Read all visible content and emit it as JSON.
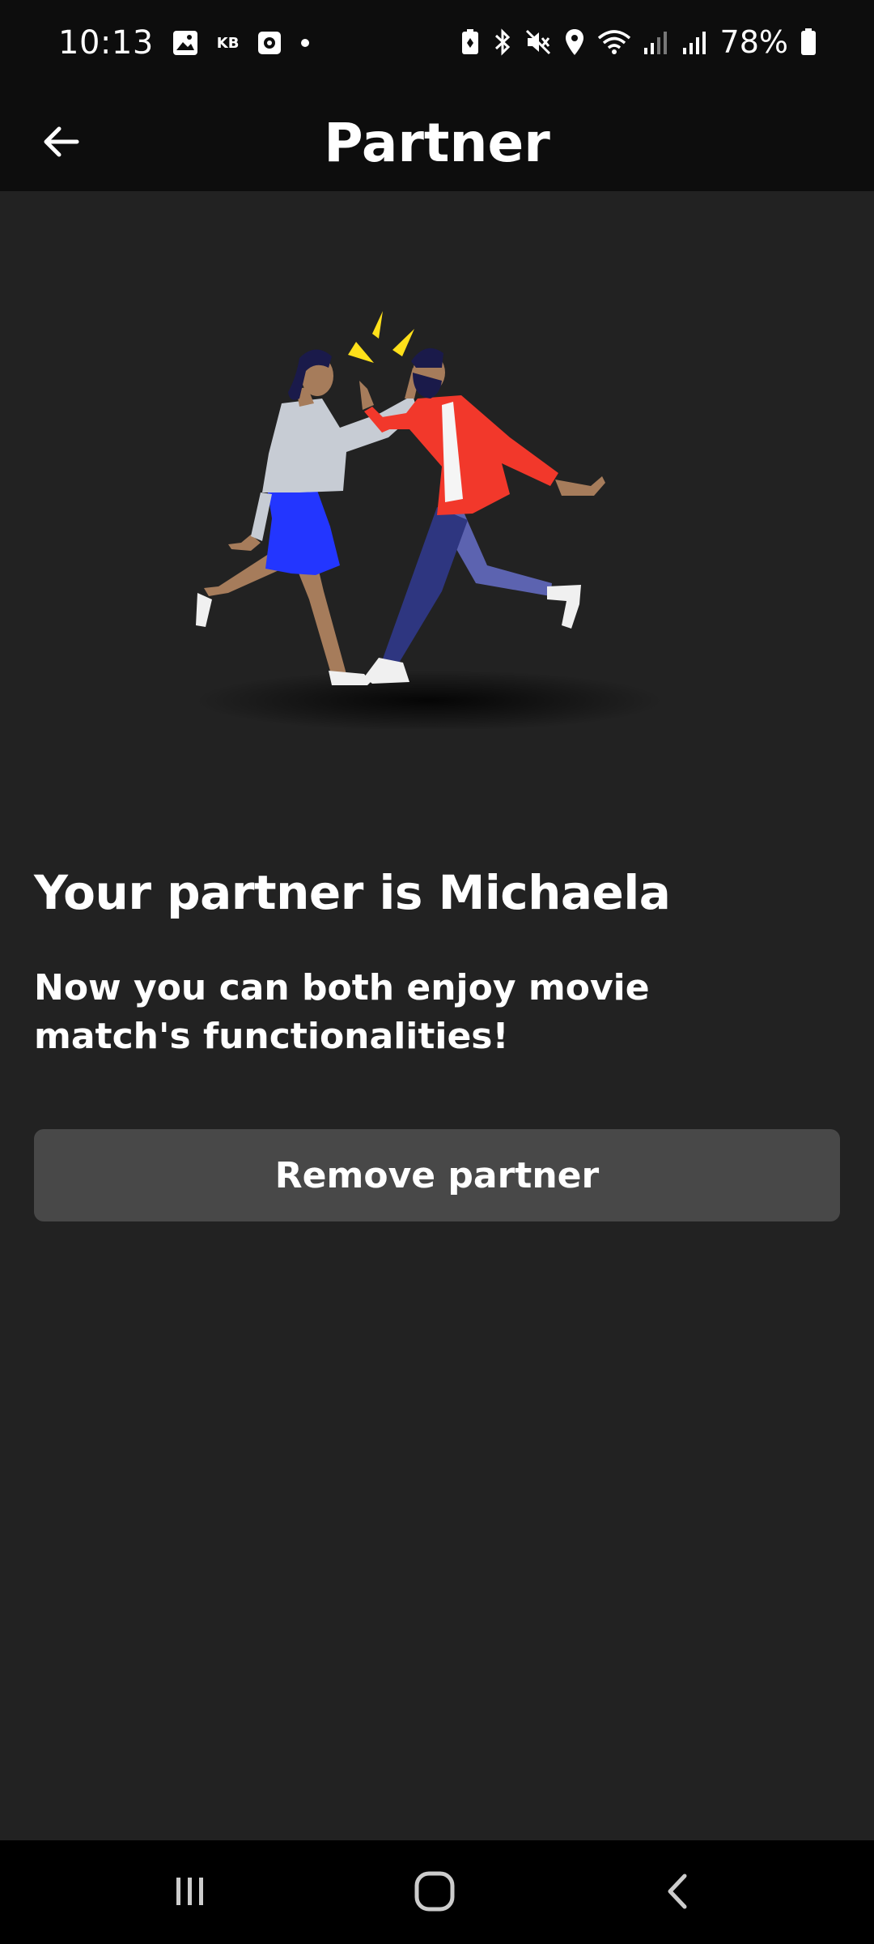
{
  "status_bar": {
    "time": "10:13",
    "carrier_badge": "KB",
    "battery_percent": "78%"
  },
  "app_bar": {
    "title": "Partner",
    "back_icon": "arrow-left-icon"
  },
  "illustration": {
    "description_icon": "high-five-illustration",
    "colors": {
      "spark": "#ffe01a",
      "woman_top": "#c7ccd4",
      "woman_skirt": "#2336ff",
      "skin": "#a67c5b",
      "man_jacket": "#f2382b",
      "man_pants_front": "#2e3680",
      "man_pants_back": "#5c63b0",
      "hair": "#1a1a4a"
    }
  },
  "content": {
    "heading": "Your partner is Michaela",
    "subtext": "Now you can both enjoy movie match's functionalities!",
    "remove_button_label": "Remove partner"
  },
  "nav_bar": {
    "recents_icon": "recents-icon",
    "home_icon": "home-icon",
    "back_icon": "back-chevron-icon"
  }
}
